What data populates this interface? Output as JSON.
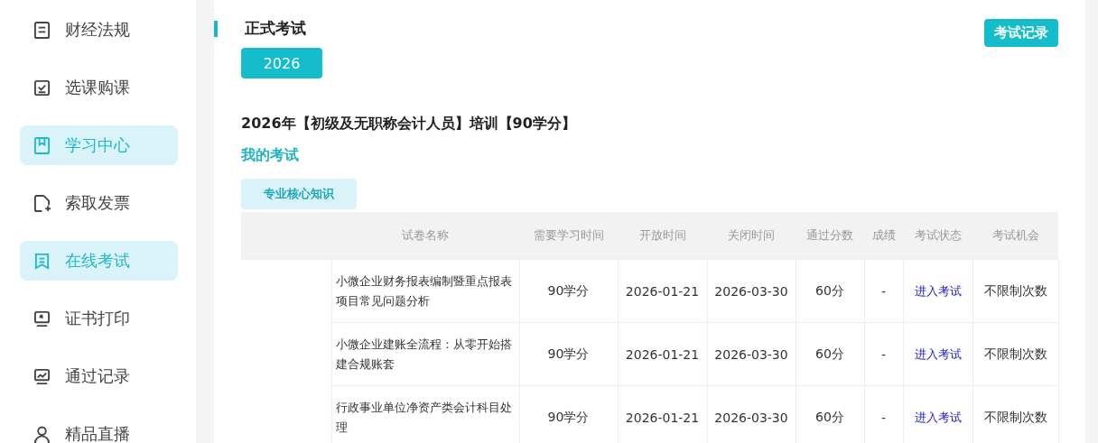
{
  "sidebar": {
    "items": [
      {
        "label": "财经法规",
        "selected": false
      },
      {
        "label": "选课购课",
        "selected": false
      },
      {
        "label": "学习中心",
        "selected": true
      },
      {
        "label": "索取发票",
        "selected": false
      },
      {
        "label": "在线考试",
        "selected": true
      },
      {
        "label": "证书打印",
        "selected": false
      },
      {
        "label": "通过记录",
        "selected": false
      },
      {
        "label": "精品直播",
        "selected": false
      }
    ]
  },
  "section_title": "正式考试",
  "record_button": "考试记录",
  "years": [
    {
      "label": "2026",
      "selected": true
    }
  ],
  "course_title": "2026年【初级及无职称会计人员】培训【90学分】",
  "my_exams_label": "我的考试",
  "categories": [
    {
      "label": "专业核心知识",
      "selected": true
    }
  ],
  "table": {
    "columns": [
      "试卷名称",
      "需要学习时间",
      "开放时间",
      "关闭时间",
      "通过分数",
      "成绩",
      "考试状态",
      "考试机会"
    ],
    "rows": [
      {
        "name": "小微企业财务报表编制暨重点报表项目常见问题分析",
        "study_time": "90学分",
        "open": "2026-01-21",
        "close": "2026-03-30",
        "pass_score": "60分",
        "score": "-",
        "status": "进入考试",
        "chances": "不限制次数"
      },
      {
        "name": "小微企业建账全流程：从零开始搭建合规账套",
        "study_time": "90学分",
        "open": "2026-01-21",
        "close": "2026-03-30",
        "pass_score": "60分",
        "score": "-",
        "status": "进入考试",
        "chances": "不限制次数"
      },
      {
        "name": "行政事业单位净资产类会计科目处理",
        "study_time": "90学分",
        "open": "2026-01-21",
        "close": "2026-03-30",
        "pass_score": "60分",
        "score": "-",
        "status": "进入考试",
        "chances": "不限制次数"
      }
    ]
  }
}
